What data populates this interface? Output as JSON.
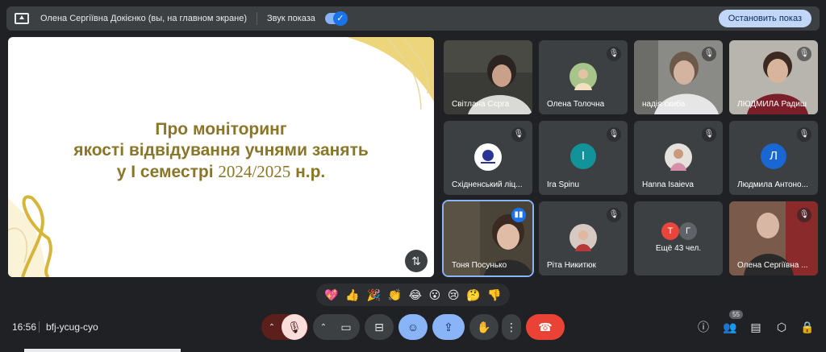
{
  "topbar": {
    "presenter": "Олена Сергіївна Докієнко (вы, на главном экране)",
    "sound_label": "Звук показа",
    "stop_label": "Остановить показ"
  },
  "slide": {
    "line1": "Про моніторинг",
    "line2": "якості відвідування учнями занять",
    "line3_prefix": "у І семестрі",
    "line3_year": "2024/2025",
    "line3_suffix": "н.р."
  },
  "participants": [
    {
      "name": "Світлана Сєрга"
    },
    {
      "name": "Олена Толочна"
    },
    {
      "name": "надія скиба"
    },
    {
      "name": "ЛЮДМИЛА Радиш"
    },
    {
      "name": "Східненський ліц..."
    },
    {
      "name": "Ira Spinu",
      "initial": "I",
      "color": "#12939a"
    },
    {
      "name": "Hanna Isaieva"
    },
    {
      "name": "Людмила Антоно...",
      "initial": "Л",
      "color": "#1967d2"
    },
    {
      "name": "Тоня Посунько"
    },
    {
      "name": "Ріта Никитюк"
    },
    {
      "name": "Ещё 43 чел.",
      "initials": [
        "Т",
        "Г"
      ]
    },
    {
      "name": "Олена Сергіївна ..."
    }
  ],
  "reactions": [
    "💖",
    "👍",
    "🎉",
    "👏",
    "😂",
    "😮",
    "😢",
    "🤔",
    "👎"
  ],
  "bottombar": {
    "time": "16:56",
    "meeting_code": "bfj-ycug-cyo",
    "participants_count": "55"
  },
  "colors": {
    "accent": "#8ab4f8",
    "end_call": "#ea4335",
    "mic_off": "#f9dedc",
    "slide_text": "#8a7628"
  }
}
